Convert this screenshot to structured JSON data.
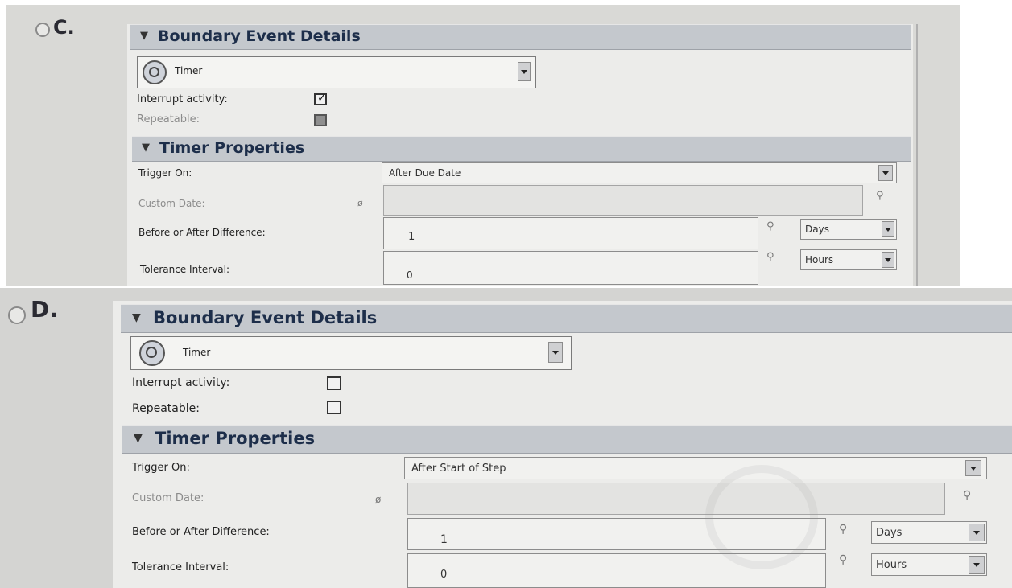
{
  "options": [
    {
      "letter": "C.",
      "boundary_header": "Boundary Event Details",
      "event_type": "Timer",
      "interrupt_label": "Interrupt activity:",
      "interrupt_checked": true,
      "repeatable_label": "Repeatable:",
      "repeatable_checked": false,
      "timer_header": "Timer Properties",
      "trigger_label": "Trigger On:",
      "trigger_value": "After Due Date",
      "custom_date_label": "Custom Date:",
      "diff_label": "Before or After Difference:",
      "diff_value": "1",
      "diff_unit": "Days",
      "tolerance_label": "Tolerance Interval:",
      "tolerance_value": "0",
      "tolerance_unit": "Hours"
    },
    {
      "letter": "D.",
      "boundary_header": "Boundary Event Details",
      "event_type": "Timer",
      "interrupt_label": "Interrupt activity:",
      "interrupt_checked": false,
      "repeatable_label": "Repeatable:",
      "repeatable_checked": false,
      "timer_header": "Timer Properties",
      "trigger_label": "Trigger On:",
      "trigger_value": "After Start of Step",
      "custom_date_label": "Custom Date:",
      "diff_label": "Before or After Difference:",
      "diff_value": "1",
      "diff_unit": "Days",
      "tolerance_label": "Tolerance Interval:",
      "tolerance_value": "0",
      "tolerance_unit": "Hours"
    }
  ],
  "icons": {
    "collapse": "triangle-down",
    "event_type": "timer-clock",
    "picker": "variable-picker",
    "dropdown": "chevron-down"
  },
  "colors": {
    "section_header_bg": "#c4c8cd",
    "header_text": "#1d2e4a",
    "panel_bg": "#ececea"
  }
}
